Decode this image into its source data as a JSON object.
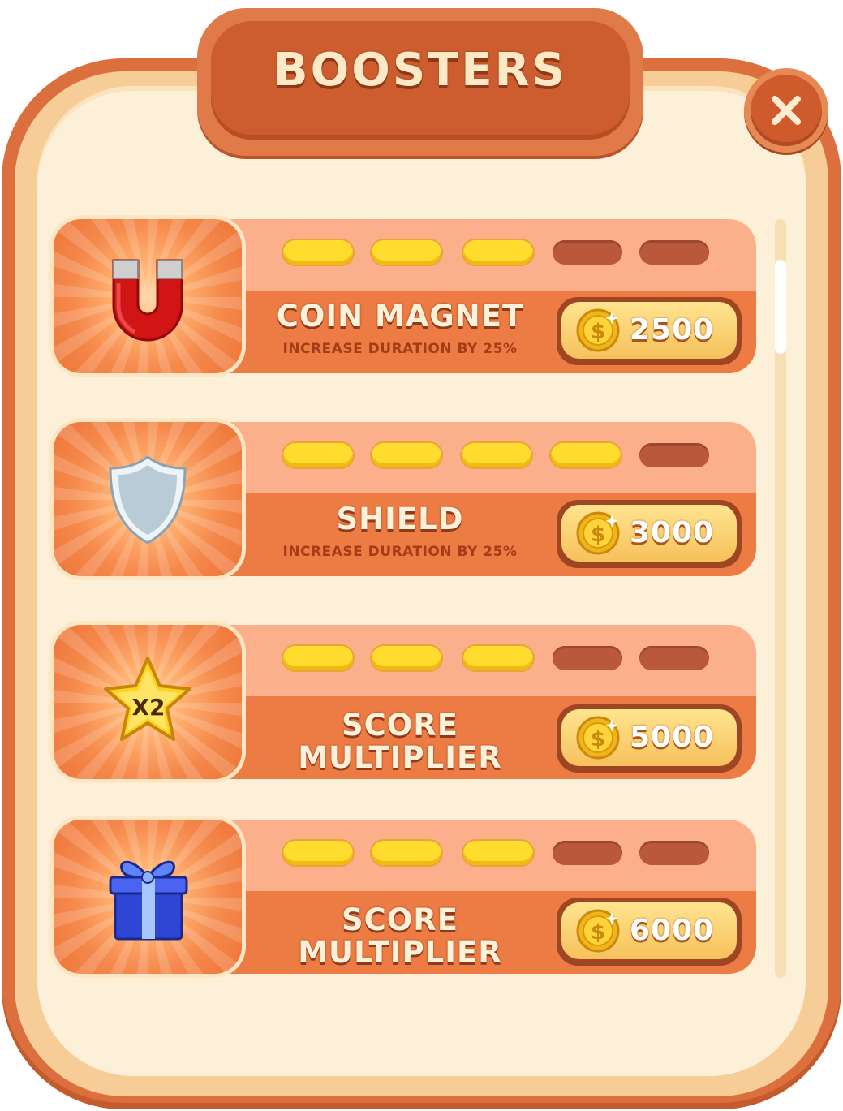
{
  "title": "BOOSTERS",
  "close_icon": "close-icon",
  "boosters": [
    {
      "icon": "magnet-icon",
      "name": "COIN MAGNET",
      "description": "INCREASE DURATION BY 25%",
      "price": "2500",
      "level": 3,
      "max_level": 5
    },
    {
      "icon": "shield-icon",
      "name": "SHIELD",
      "description": "INCREASE DURATION BY 25%",
      "price": "3000",
      "level": 4,
      "max_level": 5
    },
    {
      "icon": "star-x2-icon",
      "icon_text": "X2",
      "name_line1": "SCORE",
      "name_line2": "MULTIPLIER",
      "price": "5000",
      "level": 3,
      "max_level": 5
    },
    {
      "icon": "gift-box-icon",
      "name_line1": "SCORE",
      "name_line2": "MULTIPLIER",
      "price": "6000",
      "level": 3,
      "max_level": 5
    }
  ],
  "colors": {
    "frame": "#dc6f3e",
    "panel": "#fdf0d8",
    "level_on": "#ffdc2e",
    "level_off": "#b9583a",
    "card_top": "#fbb08b",
    "card_bottom": "#ec7b44"
  }
}
